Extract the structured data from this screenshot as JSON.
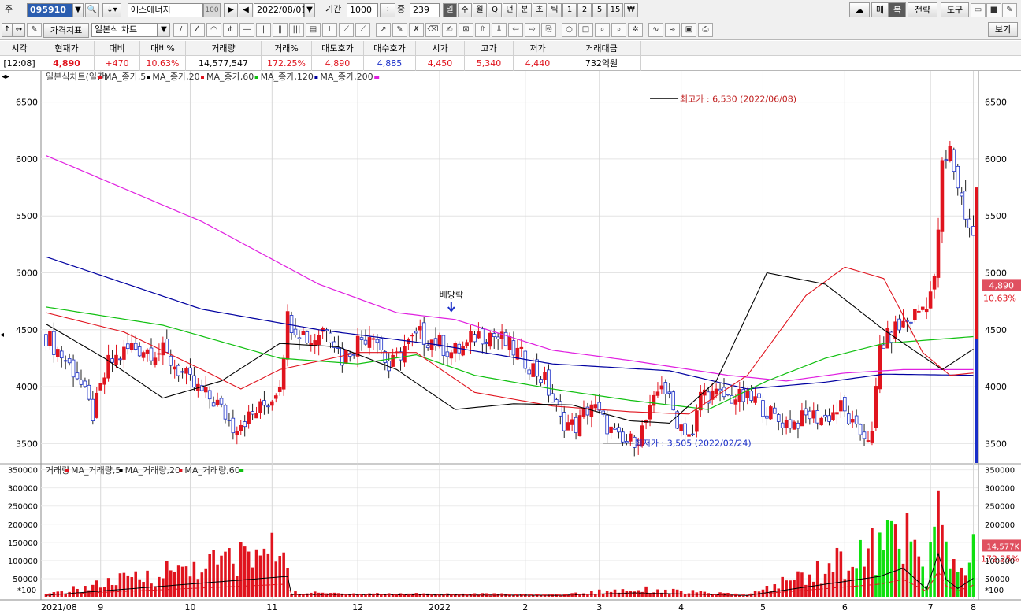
{
  "toolbar": {
    "type_label": "주",
    "stock_code": "095910",
    "stock_name": "에스에너지",
    "name_badge": "100",
    "date": "2022/08/01",
    "period_label": "기간",
    "period_value": "1000",
    "count_label": "중",
    "count_value": "239",
    "intervals": [
      "일",
      "주",
      "월",
      "Q",
      "년",
      "분",
      "초",
      "틱",
      "1",
      "2",
      "5",
      "15",
      "₩"
    ],
    "right_buttons": [
      "매",
      "복",
      "전략",
      "도구"
    ],
    "price_indicator_btn": "가격지표",
    "chart_type_select": "일본식 차트",
    "view_btn": "보기"
  },
  "quote": {
    "headers": [
      "시각",
      "현재가",
      "대비",
      "대비%",
      "거래량",
      "거래%",
      "매도호가",
      "매수호가",
      "시가",
      "고가",
      "저가",
      "거래대금"
    ],
    "values": [
      "[12:08]",
      "4,890",
      "+470",
      "10.63%",
      "14,577,547",
      "172.25%",
      "4,890",
      "4,885",
      "4,450",
      "5,340",
      "4,440",
      "732억원"
    ]
  },
  "chart_data": {
    "type": "candlestick",
    "price_legend": {
      "title": "일본식차트(일간)",
      "series": [
        {
          "name": "MA_종가,5",
          "color": "#e0141e"
        },
        {
          "name": "MA_종가,20",
          "color": "#000000"
        },
        {
          "name": "MA_종가,60",
          "color": "#e0141e"
        },
        {
          "name": "MA_종가,120",
          "color": "#10c010"
        },
        {
          "name": "MA_종가,200",
          "color": "#0000a0"
        }
      ],
      "end_marker_color": "#e020e0"
    },
    "volume_legend": {
      "title": "거래량",
      "series": [
        {
          "name": "MA_거래량,5",
          "color": "#e0141e"
        },
        {
          "name": "MA_거래량,20",
          "color": "#000000"
        },
        {
          "name": "MA_거래량,60",
          "color": "#e0141e"
        }
      ],
      "end_marker_color": "#10c010"
    },
    "price_axis": {
      "ticks": [
        "6500",
        "6000",
        "5500",
        "5000",
        "4500",
        "4000",
        "3500"
      ],
      "ylim": [
        3330,
        6760
      ]
    },
    "volume_axis": {
      "ticks": [
        "350000",
        "300000",
        "250000",
        "200000",
        "150000",
        "100000",
        "50000"
      ],
      "unit_label": "*100",
      "ylim": [
        0,
        360000
      ]
    },
    "x_tick_labels": [
      "2021/08",
      "9",
      "10",
      "11",
      "12",
      "2022",
      "2",
      "3",
      "4",
      "5",
      "6",
      "7",
      "8"
    ],
    "annotations": {
      "high": "최고가 : 6,530 (2022/06/08)",
      "low": "최저가 : 3,505 (2022/02/24)",
      "event": "배당락"
    },
    "current_price_tag": {
      "price": "4,890",
      "pct": "10.63%"
    },
    "current_volume_tag": {
      "volume": "14,577K",
      "pct": "172.25%"
    },
    "day_count": 239,
    "ma_anchors": {
      "ma20": [
        [
          0,
          4550
        ],
        [
          15,
          4250
        ],
        [
          30,
          3900
        ],
        [
          45,
          4050
        ],
        [
          60,
          4380
        ],
        [
          75,
          4350
        ],
        [
          90,
          4150
        ],
        [
          105,
          3800
        ],
        [
          120,
          3850
        ],
        [
          135,
          3840
        ],
        [
          150,
          3700
        ],
        [
          160,
          3680
        ],
        [
          172,
          4050
        ],
        [
          185,
          5000
        ],
        [
          200,
          4900
        ],
        [
          215,
          4500
        ],
        [
          230,
          4150
        ],
        [
          238,
          4330
        ]
      ],
      "ma60": [
        [
          0,
          4650
        ],
        [
          20,
          4480
        ],
        [
          40,
          4150
        ],
        [
          50,
          3980
        ],
        [
          60,
          4150
        ],
        [
          80,
          4300
        ],
        [
          95,
          4300
        ],
        [
          110,
          3950
        ],
        [
          130,
          3830
        ],
        [
          150,
          3780
        ],
        [
          165,
          3760
        ],
        [
          180,
          4100
        ],
        [
          195,
          4800
        ],
        [
          205,
          5050
        ],
        [
          215,
          4950
        ],
        [
          225,
          4300
        ],
        [
          232,
          4100
        ],
        [
          238,
          4120
        ]
      ],
      "ma120": [
        [
          0,
          4700
        ],
        [
          30,
          4540
        ],
        [
          60,
          4250
        ],
        [
          80,
          4200
        ],
        [
          95,
          4280
        ],
        [
          110,
          4100
        ],
        [
          130,
          3980
        ],
        [
          150,
          3880
        ],
        [
          170,
          3800
        ],
        [
          185,
          4050
        ],
        [
          200,
          4250
        ],
        [
          215,
          4380
        ],
        [
          238,
          4440
        ]
      ],
      "ma200": [
        [
          0,
          5140
        ],
        [
          40,
          4680
        ],
        [
          70,
          4500
        ],
        [
          100,
          4370
        ],
        [
          130,
          4200
        ],
        [
          160,
          4140
        ],
        [
          180,
          3980
        ],
        [
          200,
          4040
        ],
        [
          215,
          4110
        ],
        [
          238,
          4100
        ]
      ],
      "ma240": [
        [
          0,
          6030
        ],
        [
          40,
          5450
        ],
        [
          70,
          4900
        ],
        [
          90,
          4650
        ],
        [
          105,
          4590
        ],
        [
          130,
          4320
        ],
        [
          150,
          4230
        ],
        [
          175,
          4100
        ],
        [
          190,
          4050
        ],
        [
          205,
          4120
        ],
        [
          220,
          4150
        ],
        [
          238,
          4150
        ]
      ]
    },
    "price_anchors": [
      [
        0,
        4450
      ],
      [
        8,
        4100
      ],
      [
        12,
        3750
      ],
      [
        16,
        4200
      ],
      [
        22,
        4350
      ],
      [
        30,
        4300
      ],
      [
        38,
        4000
      ],
      [
        44,
        3850
      ],
      [
        48,
        3650
      ],
      [
        53,
        3750
      ],
      [
        58,
        3900
      ],
      [
        60,
        4050
      ],
      [
        62,
        4600
      ],
      [
        68,
        4400
      ],
      [
        72,
        4550
      ],
      [
        76,
        4250
      ],
      [
        80,
        4400
      ],
      [
        84,
        4500
      ],
      [
        88,
        4150
      ],
      [
        92,
        4350
      ],
      [
        96,
        4450
      ],
      [
        100,
        4400
      ],
      [
        104,
        4300
      ],
      [
        108,
        4350
      ],
      [
        110,
        4450
      ],
      [
        114,
        4470
      ],
      [
        118,
        4380
      ],
      [
        124,
        4200
      ],
      [
        128,
        4050
      ],
      [
        132,
        3700
      ],
      [
        136,
        3650
      ],
      [
        140,
        3850
      ],
      [
        144,
        3650
      ],
      [
        148,
        3500
      ],
      [
        152,
        3550
      ],
      [
        156,
        3850
      ],
      [
        158,
        4050
      ],
      [
        162,
        3700
      ],
      [
        166,
        3550
      ],
      [
        168,
        3950
      ],
      [
        172,
        3920
      ],
      [
        178,
        3900
      ],
      [
        182,
        3880
      ],
      [
        188,
        3700
      ],
      [
        192,
        3680
      ],
      [
        196,
        3750
      ],
      [
        200,
        3720
      ],
      [
        204,
        3820
      ],
      [
        208,
        3600
      ],
      [
        212,
        3560
      ],
      [
        214,
        4350
      ],
      [
        218,
        4500
      ],
      [
        222,
        4600
      ],
      [
        225,
        4700
      ],
      [
        228,
        4900
      ],
      [
        230,
        5900
      ],
      [
        232,
        6050
      ],
      [
        235,
        5650
      ],
      [
        238,
        5300
      ]
    ],
    "volume_anchors": [
      [
        0,
        6000
      ],
      [
        62,
        155000
      ],
      [
        63,
        12000
      ],
      [
        105,
        9000
      ],
      [
        132,
        6000
      ],
      [
        151,
        25000
      ],
      [
        180,
        5000
      ],
      [
        214,
        155000
      ],
      [
        220,
        220000
      ],
      [
        226,
        55000
      ],
      [
        229,
        335000
      ],
      [
        231,
        130000
      ],
      [
        234,
        60000
      ],
      [
        238,
        140000
      ]
    ]
  }
}
